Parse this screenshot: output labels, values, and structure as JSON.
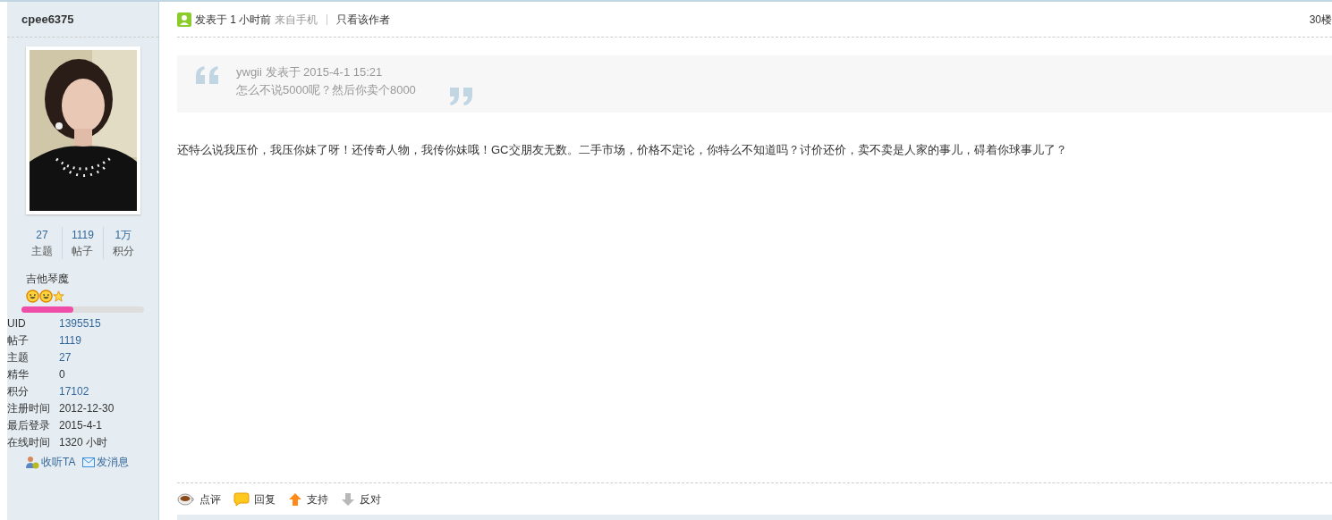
{
  "author": {
    "name": "cpee6375",
    "stats": [
      {
        "value": "27",
        "label": "主题"
      },
      {
        "value": "1119",
        "label": "帖子"
      },
      {
        "value": "1万",
        "label": "积分"
      }
    ],
    "rank": "吉他琴魔",
    "rank_icons": [
      {
        "kind": "smiley"
      },
      {
        "kind": "smiley"
      },
      {
        "kind": "star"
      }
    ],
    "progress": {
      "level": 0.42
    },
    "info": [
      {
        "label": "UID",
        "value": "1395515",
        "link": true
      },
      {
        "label": "帖子",
        "value": "1119",
        "link": true
      },
      {
        "label": "主题",
        "value": "27",
        "link": true
      },
      {
        "label": "精华",
        "value": "0",
        "link": false
      },
      {
        "label": "积分",
        "value": "17102",
        "link": true
      },
      {
        "label": "注册时间",
        "value": "2012-12-30",
        "link": false
      },
      {
        "label": "最后登录",
        "value": "2015-4-1",
        "link": false
      },
      {
        "label": "在线时间",
        "value": "1320 小时",
        "link": false
      }
    ],
    "actions": [
      {
        "kind": "follow",
        "label": "收听TA"
      },
      {
        "kind": "message",
        "label": "发消息"
      }
    ]
  },
  "post": {
    "posted": "发表于 1 小时前",
    "source": "来自手机",
    "only_author": "只看该作者",
    "floor": "30楼",
    "quote": {
      "header": "ywgii 发表于 2015-4-1 15:21",
      "text": "怎么不说5000呢？然后你卖个8000"
    },
    "body": "还特么说我压价，我压你妹了呀！还传奇人物，我传你妹哦！GC交朋友无数。二手市场，价格不定论，你特么不知道吗？讨价还价，卖不卖是人家的事儿，碍着你球事儿了？",
    "actions": [
      {
        "kind": "comment",
        "label": "点评"
      },
      {
        "kind": "reply",
        "label": "回复"
      },
      {
        "kind": "support",
        "label": "支持"
      },
      {
        "kind": "oppose",
        "label": "反对"
      }
    ]
  }
}
